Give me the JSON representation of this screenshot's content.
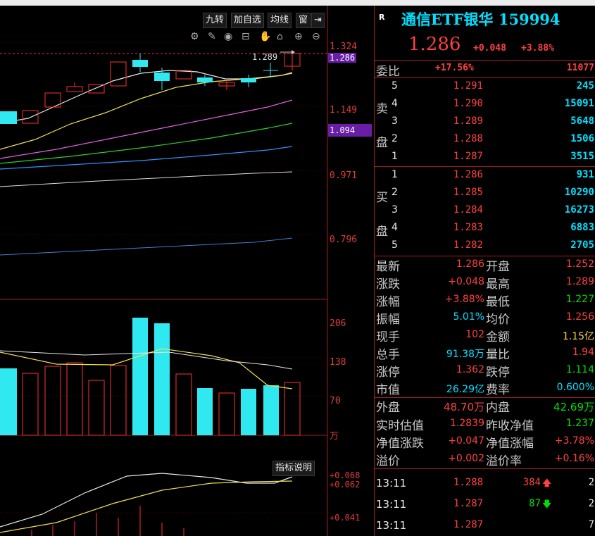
{
  "toolbar": {
    "buttons": [
      "九转",
      "加自选",
      "均线",
      "窗"
    ],
    "indicator_button": "指标说明"
  },
  "icons": [
    "settings-icon",
    "pen-icon",
    "eye-icon",
    "lock-open-icon",
    "hand-icon",
    "lock-icon",
    "zoom-in-icon",
    "zoom-out-icon"
  ],
  "price_axis": {
    "ticks": [
      "1.324",
      "1.149",
      "0.971",
      "0.796"
    ],
    "current_tag": "1.286",
    "mark_tag": "1.094",
    "high_label": "1.289"
  },
  "volume_axis": {
    "ticks": [
      "206",
      "138",
      "70"
    ],
    "unit": "万"
  },
  "macd_axis": {
    "ticks": [
      "+0.068",
      "+0.062",
      "+0.041"
    ]
  },
  "quote": {
    "badge": "R",
    "title": "通信ETF银华 159994",
    "price": "1.286",
    "change": "+0.048",
    "change_pct": "+3.88%"
  },
  "weibi": {
    "label": "委比",
    "pct": "+17.56%",
    "diff": "11077"
  },
  "sell": {
    "label_top": "卖",
    "label_bottom": "盘",
    "levels": [
      {
        "n": "5",
        "price": "1.291",
        "vol": "245"
      },
      {
        "n": "4",
        "price": "1.290",
        "vol": "15091"
      },
      {
        "n": "3",
        "price": "1.289",
        "vol": "5648"
      },
      {
        "n": "2",
        "price": "1.288",
        "vol": "1506"
      },
      {
        "n": "1",
        "price": "1.287",
        "vol": "3515"
      }
    ]
  },
  "buy": {
    "label_top": "买",
    "label_bottom": "盘",
    "levels": [
      {
        "n": "1",
        "price": "1.286",
        "vol": "931"
      },
      {
        "n": "2",
        "price": "1.285",
        "vol": "10290"
      },
      {
        "n": "3",
        "price": "1.284",
        "vol": "16273"
      },
      {
        "n": "4",
        "price": "1.283",
        "vol": "6883"
      },
      {
        "n": "5",
        "price": "1.282",
        "vol": "2705"
      }
    ]
  },
  "stats": [
    {
      "l1": "最新",
      "v1": "1.286",
      "l2": "开盘",
      "v2": "1.252"
    },
    {
      "l1": "涨跌",
      "v1": "+0.048",
      "l2": "最高",
      "v2": "1.289"
    },
    {
      "l1": "涨幅",
      "v1": "+3.88%",
      "l2": "最低",
      "v2": "1.227"
    },
    {
      "l1": "振幅",
      "v1": "5.01%",
      "l2": "均价",
      "v2": "1.256"
    },
    {
      "l1": "现手",
      "v1": "102",
      "l2": "金额",
      "v2": "1.15亿"
    },
    {
      "l1": "总手",
      "v1": "91.38万",
      "l2": "量比",
      "v2": "1.94"
    },
    {
      "l1": "涨停",
      "v1": "1.362",
      "l2": "跌停",
      "v2": "1.114"
    },
    {
      "l1": "市值",
      "v1": "26.29亿",
      "l2": "费率",
      "v2": "0.600%"
    }
  ],
  "flow": {
    "outer_label": "外盘",
    "outer": "48.70万",
    "inner_label": "内盘",
    "inner": "42.69万"
  },
  "nav": [
    {
      "l1": "实时估值",
      "v1": "1.2839",
      "l2": "昨收净值",
      "v2": "1.237"
    },
    {
      "l1": "净值涨跌",
      "v1": "+0.047",
      "l2": "净值涨幅",
      "v2": "+3.78%"
    },
    {
      "l1": "溢价",
      "v1": "+0.002",
      "l2": "溢价率",
      "v2": "+0.16%"
    }
  ],
  "ticks": [
    {
      "time": "13:11",
      "price": "1.288",
      "vol": "384",
      "dir": "up",
      "count": "2"
    },
    {
      "time": "13:11",
      "price": "1.287",
      "vol": "87",
      "dir": "down",
      "count": "2"
    },
    {
      "time": "13:11",
      "price": "1.287",
      "vol": "",
      "dir": "",
      "count": "7"
    }
  ],
  "colors": {
    "up": "#ff4040",
    "down": "#00e000",
    "cyan": "#00e0ff",
    "accent": "#a02020"
  }
}
